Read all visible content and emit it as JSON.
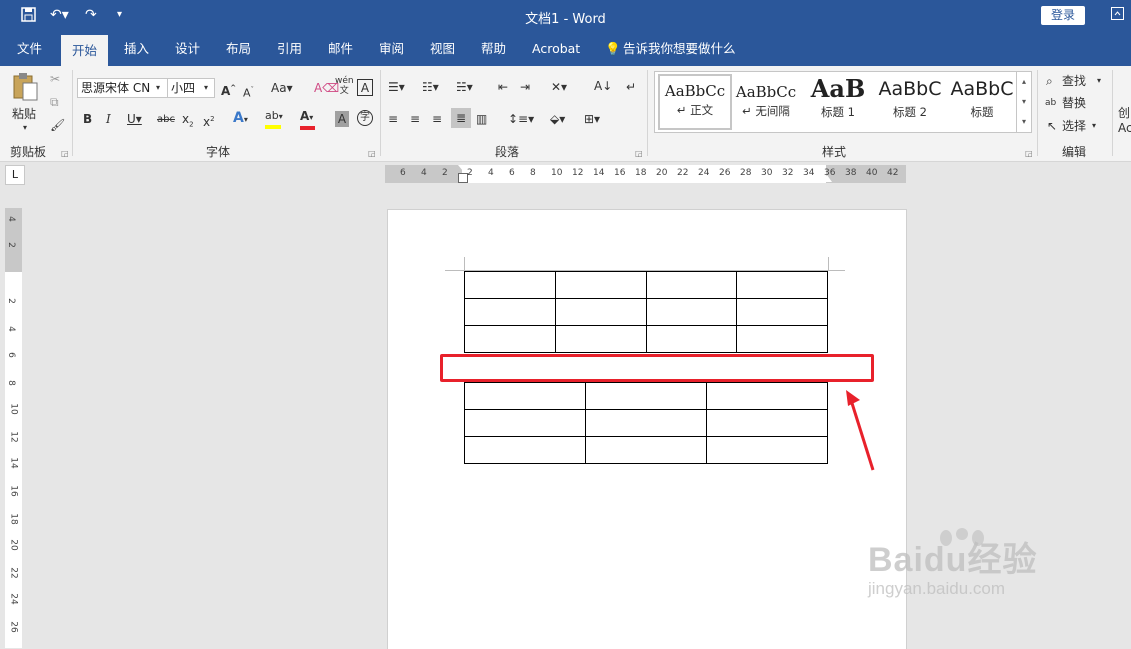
{
  "titlebar": {
    "doc_title": "文档1  -  Word",
    "login_label": "登录"
  },
  "menu": {
    "tabs": [
      "文件",
      "开始",
      "插入",
      "设计",
      "布局",
      "引用",
      "邮件",
      "审阅",
      "视图",
      "帮助",
      "Acrobat"
    ],
    "active_tab": "开始",
    "tell_me": "告诉我你想要做什么"
  },
  "ribbon": {
    "clipboard": {
      "paste_label": "粘贴",
      "group_label": "剪贴板"
    },
    "font": {
      "font_name": "思源宋体 CN",
      "font_size": "小四",
      "group_label": "字体",
      "wen_label": "wén\n文"
    },
    "paragraph": {
      "group_label": "段落"
    },
    "styles": {
      "items": [
        {
          "sample": "AaBbCc",
          "name": "↵ 正文"
        },
        {
          "sample": "AaBbCc",
          "name": "↵ 无间隔"
        },
        {
          "sample": "AaB",
          "name": "标题 1"
        },
        {
          "sample": "AaBbC",
          "name": "标题 2"
        },
        {
          "sample": "AaBbC",
          "name": "标题"
        }
      ],
      "group_label": "样式"
    },
    "editing": {
      "find": "查找",
      "replace": "替换",
      "select": "选择",
      "group_label": "编辑"
    },
    "cut_off": {
      "line1": "创",
      "line2": "Ac"
    }
  },
  "ruler": {
    "h_ticks": [
      "6",
      "4",
      "2",
      "2",
      "4",
      "6",
      "8",
      "10",
      "12",
      "14",
      "16",
      "18",
      "20",
      "22",
      "24",
      "26",
      "28",
      "30",
      "32",
      "34",
      "36",
      "38",
      "40",
      "42"
    ],
    "v_ticks": [
      "4",
      "2",
      "2",
      "4",
      "6",
      "8",
      "10",
      "12",
      "14",
      "16",
      "18",
      "20",
      "22",
      "24",
      "26"
    ]
  },
  "document": {
    "table1": {
      "rows": 3,
      "cols": 4
    },
    "table2": {
      "rows": 3,
      "cols": 3
    }
  },
  "annotation": {
    "color": "#e8212b"
  },
  "watermark": {
    "brand": "Baidu经验",
    "url": "jingyan.baidu.com"
  },
  "colors": {
    "accent": "#2b579a",
    "highlight": "#ffff00",
    "font_color": "#e8212b"
  }
}
